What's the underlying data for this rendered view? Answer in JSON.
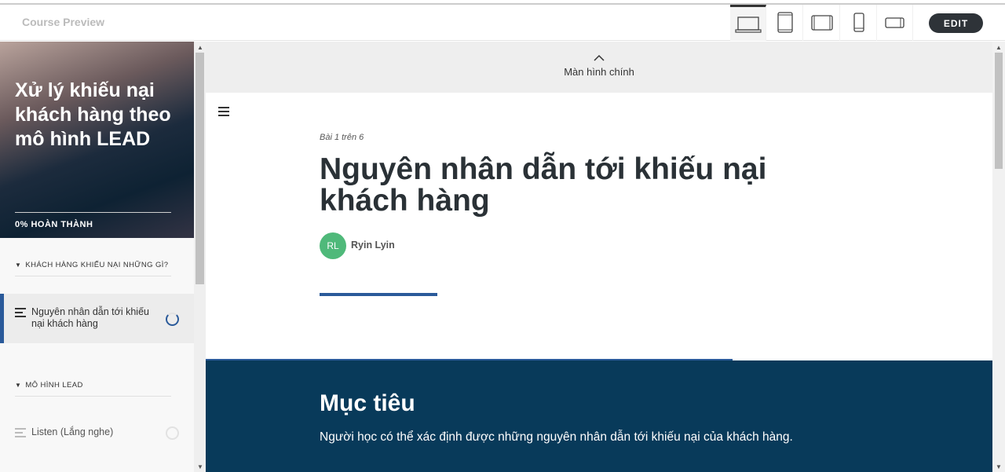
{
  "topbar": {
    "title": "Course Preview",
    "edit_label": "EDIT",
    "devices": [
      "laptop-icon",
      "tablet-icon",
      "tablet-landscape-icon",
      "phone-icon",
      "phone-landscape-icon"
    ]
  },
  "sidebar": {
    "course_title": "Xử lý khiếu nại khách hàng theo mô hình LEAD",
    "progress_label": "0% HOÀN THÀNH",
    "progress": 0,
    "sections": [
      {
        "label": "KHÁCH HÀNG KHIẾU NẠI NHỮNG GÌ?",
        "lessons": [
          {
            "label": "Nguyên nhân dẫn tới khiếu nại khách hàng",
            "active": true
          }
        ]
      },
      {
        "label": "MÔ HÌNH LEAD",
        "lessons": [
          {
            "label": "Listen (Lắng nghe)",
            "active": false
          }
        ]
      }
    ]
  },
  "main": {
    "prev_label": "Màn hình chính",
    "crumb": "Bài 1 trên 6",
    "title": "Nguyên nhân dẫn tới khiếu nại khách hàng",
    "author_initials": "RL",
    "author": "Ryin Lyin",
    "section_title": "Mục tiêu",
    "section_text": "Người học có thể xác định được những nguyên nhân dẫn tới khiếu nại của khách hàng."
  },
  "colors": {
    "accent": "#2a5a9a",
    "dark": "#083a5a",
    "avatar": "#4fb97a"
  }
}
